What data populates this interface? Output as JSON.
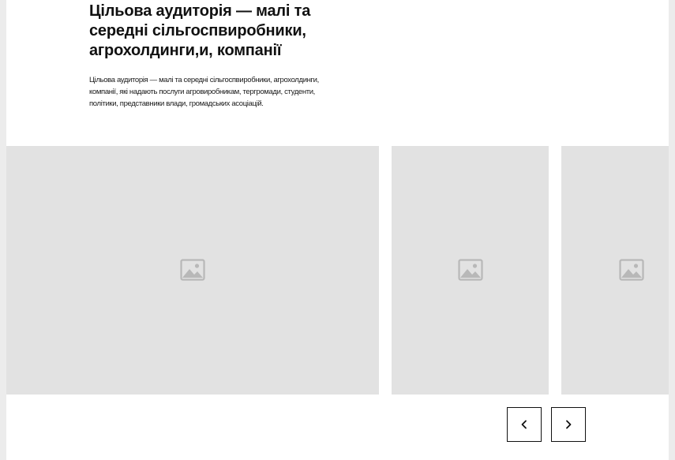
{
  "section": {
    "title": "Цільова аудиторія — малі та середні сільгоспвиробники, агрохолдинги,и, компанії",
    "description": "Цільова аудиторія — малі та середні сільгоспвиробники, агрохолдинги, компанії, які надають послуги агровиробникам, тергромади, студенти, політики, представники влади, громадських асоціацій."
  },
  "gallery": {
    "slides": [
      {
        "icon": "image-placeholder-icon"
      },
      {
        "icon": "image-placeholder-icon"
      },
      {
        "icon": "image-placeholder-icon"
      }
    ]
  },
  "navigation": {
    "prev_icon": "chevron-left-icon",
    "next_icon": "chevron-right-icon"
  },
  "colors": {
    "page_background": "#ececec",
    "content_background": "#ffffff",
    "placeholder": "#e2e2e2",
    "placeholder_icon": "#b8b8b8",
    "text": "#111111"
  }
}
